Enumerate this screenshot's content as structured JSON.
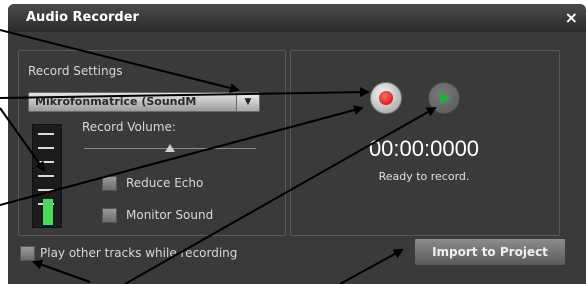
{
  "window": {
    "title": "Audio Recorder",
    "close_glyph": "×"
  },
  "record_settings": {
    "label": "Record Settings",
    "device_dropdown": {
      "selected": "Mikrofonmatrice (SoundM"
    }
  },
  "volume": {
    "label": "Record Volume:",
    "slider_level": 0.5,
    "meter_level": 0.25
  },
  "options": {
    "reduce_echo": "Reduce Echo",
    "monitor_sound": "Monitor Sound",
    "play_other_tracks": "Play other tracks while recording"
  },
  "transport": {
    "record_icon": "record-icon",
    "play_icon": "play-icon",
    "timer": "00:00:0000",
    "status": "Ready to record."
  },
  "actions": {
    "import_label": "Import to Project"
  },
  "colors": {
    "background": "#3a3a3a",
    "record_red": "#d10000",
    "play_green": "#2fa840",
    "meter_green": "#4dd85a"
  }
}
